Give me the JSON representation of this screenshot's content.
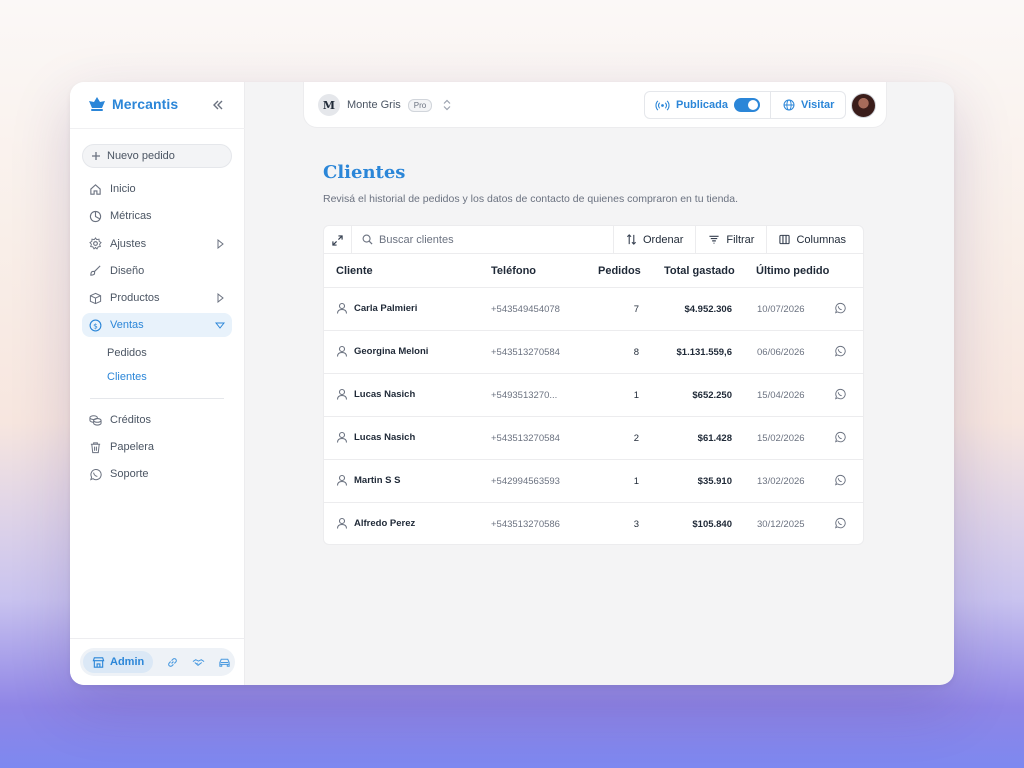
{
  "app": {
    "name": "Mercantis"
  },
  "sidebar": {
    "new_order_label": "Nuevo pedido",
    "items": [
      {
        "label": "Inicio",
        "icon": "home-icon"
      },
      {
        "label": "Métricas",
        "icon": "pie-chart-icon"
      },
      {
        "label": "Ajustes",
        "icon": "gear-icon"
      },
      {
        "label": "Diseño",
        "icon": "brush-icon"
      },
      {
        "label": "Productos",
        "icon": "box-icon"
      },
      {
        "label": "Ventas",
        "icon": "dollar-circle-icon"
      }
    ],
    "subitems": [
      {
        "label": "Pedidos"
      },
      {
        "label": "Clientes"
      }
    ],
    "items2": [
      {
        "label": "Créditos",
        "icon": "coins-icon"
      },
      {
        "label": "Papelera",
        "icon": "trash-icon"
      },
      {
        "label": "Soporte",
        "icon": "whatsapp-icon"
      }
    ],
    "bottom": {
      "admin_label": "Admin"
    }
  },
  "topbar": {
    "store_initial": "M",
    "store_name": "Monte Gris",
    "plan_badge": "Pro",
    "published_label": "Publicada",
    "visit_label": "Visitar"
  },
  "page": {
    "title": "Clientes",
    "subtitle": "Revisá el historial de pedidos y los datos de contacto de quienes compraron en tu tienda."
  },
  "toolbar": {
    "search_placeholder": "Buscar clientes",
    "sort_label": "Ordenar",
    "filter_label": "Filtrar",
    "columns_label": "Columnas"
  },
  "table": {
    "headers": {
      "client": "Cliente",
      "phone": "Teléfono",
      "orders": "Pedidos",
      "total": "Total gastado",
      "last_order": "Último pedido"
    },
    "rows": [
      {
        "name": "Carla Palmieri",
        "phone": "+543549454078",
        "orders": "7",
        "total": "$4.952.306",
        "last": "10/07/2026"
      },
      {
        "name": "Georgina Meloni",
        "phone": "+543513270584",
        "orders": "8",
        "total": "$1.131.559,6",
        "last": "06/06/2026"
      },
      {
        "name": "Lucas Nasich",
        "phone": "+5493513270...",
        "orders": "1",
        "total": "$652.250",
        "last": "15/04/2026"
      },
      {
        "name": "Lucas Nasich",
        "phone": "+543513270584",
        "orders": "2",
        "total": "$61.428",
        "last": "15/02/2026"
      },
      {
        "name": "Martin S S",
        "phone": "+542994563593",
        "orders": "1",
        "total": "$35.910",
        "last": "13/02/2026"
      },
      {
        "name": "Alfredo Perez",
        "phone": "+543513270586",
        "orders": "3",
        "total": "$105.840",
        "last": "30/12/2025"
      }
    ]
  },
  "colors": {
    "accent": "#2b86d8",
    "accent_soft": "#e8f2fb"
  }
}
